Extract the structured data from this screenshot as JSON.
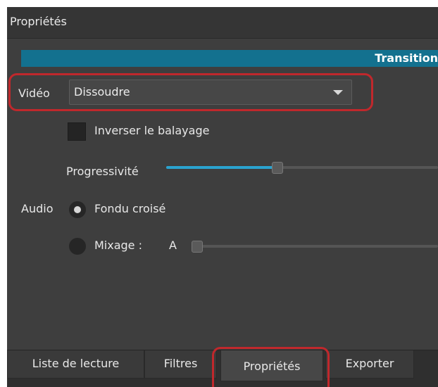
{
  "panel": {
    "title": "Propriétés"
  },
  "transition": {
    "header": "Transition"
  },
  "video": {
    "label": "Vidéo",
    "selected": "Dissoudre",
    "invert_label": "Inverser le balayage",
    "invert_checked": false,
    "softness_label": "Progressivité",
    "softness_level_percent": 41
  },
  "audio": {
    "label": "Audio",
    "crossfade_label": "Fondu croisé",
    "crossfade_selected": true,
    "mix_label": "Mixage :",
    "mix_side": "A",
    "mix_level_percent": 0
  },
  "tabs": [
    {
      "label": "Liste de lecture",
      "active": false
    },
    {
      "label": "Filtres",
      "active": false
    },
    {
      "label": "Propriétés",
      "active": true
    },
    {
      "label": "Exporter",
      "active": false
    }
  ],
  "colors": {
    "accent": "#2aa3cf",
    "header_bar": "#13718f",
    "highlight": "#c0282c"
  }
}
